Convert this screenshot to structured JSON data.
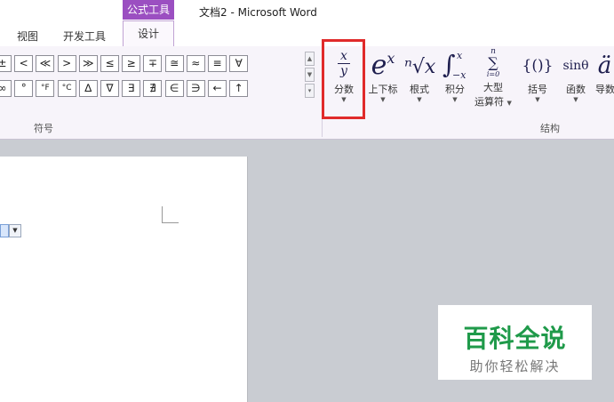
{
  "titlebar": {
    "contextual_tab": "公式工具",
    "window_title": "文档2 - Microsoft Word"
  },
  "tabs": [
    {
      "label": "视图"
    },
    {
      "label": "开发工具"
    },
    {
      "label": "设计",
      "active": true
    }
  ],
  "ribbon": {
    "symbols_group_label": "符号",
    "structures_group_label": "结构",
    "symbols_row1": [
      "±",
      "<",
      "≪",
      ">",
      "≫",
      "≤",
      "≥",
      "∓",
      "≅",
      "≈",
      "≡",
      "∀"
    ],
    "symbols_row2": [
      "∞",
      "°",
      "°F",
      "°C",
      "∆",
      "∇",
      "∃",
      "∄",
      "∈",
      "∋",
      "←",
      "↑"
    ],
    "structures": [
      {
        "name": "fraction",
        "glyph_top": "x",
        "glyph_bottom": "y",
        "label": "分数",
        "icon": "fraction-icon"
      },
      {
        "name": "script",
        "glyph": "e",
        "glyph_sup": "x",
        "label": "上下标",
        "icon": "script-icon"
      },
      {
        "name": "radical",
        "glyph": "ⁿ√x",
        "label": "根式",
        "icon": "radical-icon"
      },
      {
        "name": "integral",
        "glyph": "∫",
        "glyph_sup": "x",
        "glyph_sub": "−x",
        "label": "积分",
        "icon": "integral-icon"
      },
      {
        "name": "large-operator",
        "glyph_top": "n",
        "glyph": "∑",
        "glyph_bottom": "i=0",
        "label": "大型",
        "label2": "运算符",
        "icon": "large-operator-icon"
      },
      {
        "name": "bracket",
        "glyph": "{()}",
        "label": "括号",
        "icon": "bracket-icon"
      },
      {
        "name": "function",
        "glyph": "sinθ",
        "label": "函数",
        "icon": "function-icon"
      },
      {
        "name": "accent",
        "glyph": "ä",
        "label": "导数",
        "icon": "accent-icon"
      }
    ]
  },
  "watermark": {
    "title": "百科全说",
    "subtitle": "助你轻松解决"
  },
  "colors": {
    "contextual_tab": "#9b4fc1",
    "highlight": "#e02a2a",
    "watermark_green": "#1f9a4a"
  }
}
